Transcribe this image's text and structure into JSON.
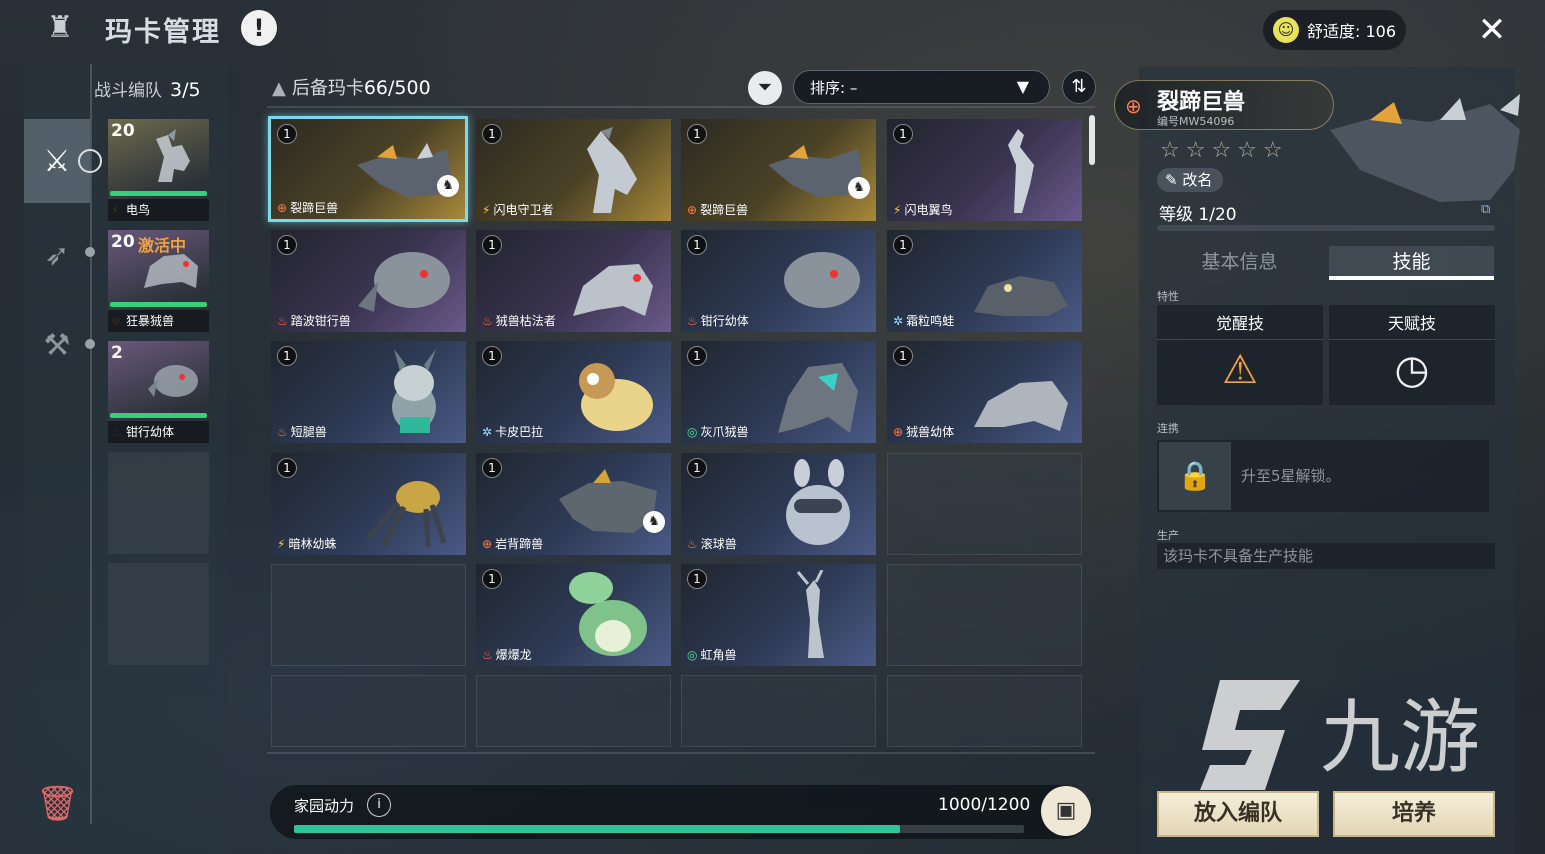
{
  "header": {
    "title": "玛卡管理",
    "comfort_label": "舒适度: 106"
  },
  "team": {
    "label": "战斗编队",
    "count": "3/5",
    "slots": [
      {
        "level": "20",
        "name": "电鸟",
        "element": "electric",
        "active": ""
      },
      {
        "level": "20",
        "name": "狂暴狨兽",
        "element": "earth",
        "active": "激活中"
      },
      {
        "level": "2",
        "name": "钳行幼体",
        "element": "fire",
        "active": ""
      }
    ]
  },
  "reserve": {
    "label": "后备玛卡",
    "count": "66/500",
    "sort_label": "排序: –",
    "cards": [
      {
        "qty": "1",
        "name": "裂蹄巨兽",
        "element": "earth"
      },
      {
        "qty": "1",
        "name": "闪电守卫者",
        "element": "electric"
      },
      {
        "qty": "1",
        "name": "裂蹄巨兽",
        "element": "earth"
      },
      {
        "qty": "1",
        "name": "闪电翼鸟",
        "element": "electric"
      },
      {
        "qty": "1",
        "name": "踏波钳行兽",
        "element": "fire"
      },
      {
        "qty": "1",
        "name": "狨兽枯法者",
        "element": "fire"
      },
      {
        "qty": "1",
        "name": "钳行幼体",
        "element": "fire"
      },
      {
        "qty": "1",
        "name": "霜粒鸣蛙",
        "element": "ice"
      },
      {
        "qty": "1",
        "name": "短腿兽",
        "element": "fire"
      },
      {
        "qty": "1",
        "name": "卡皮巴拉",
        "element": "ice"
      },
      {
        "qty": "1",
        "name": "灰爪狨兽",
        "element": "grass"
      },
      {
        "qty": "1",
        "name": "狨兽幼体",
        "element": "earth"
      },
      {
        "qty": "1",
        "name": "暗林幼蛛",
        "element": "electric"
      },
      {
        "qty": "1",
        "name": "岩背蹄兽",
        "element": "earth"
      },
      {
        "qty": "1",
        "name": "滚球兽",
        "element": "fire"
      },
      {
        "qty": "1",
        "name": "爆爆龙",
        "element": "fire"
      },
      {
        "qty": "1",
        "name": "虹角兽",
        "element": "grass"
      }
    ]
  },
  "power": {
    "label": "家园动力",
    "value": "1000/1200",
    "fraction": 0.83
  },
  "detail": {
    "name": "裂蹄巨兽",
    "serial": "编号MW54096",
    "rename": "改名",
    "level": "等级 1/20",
    "tabs": [
      "基本信息",
      "技能"
    ],
    "trait_label": "特性",
    "skill1": "觉醒技",
    "skill2": "天赋技",
    "link_label": "连携",
    "link_text": "升至5星解锁。",
    "prod_label": "生产",
    "prod_text": "该玛卡不具备生产技能",
    "btn_team": "放入编队",
    "btn_train": "培养"
  },
  "watermark": "九游",
  "colors": {
    "accent_cyan": "#7ad9ea",
    "power_green": "#2ec49a",
    "hp_green": "#36d07a",
    "active_orange": "#f0a040"
  }
}
